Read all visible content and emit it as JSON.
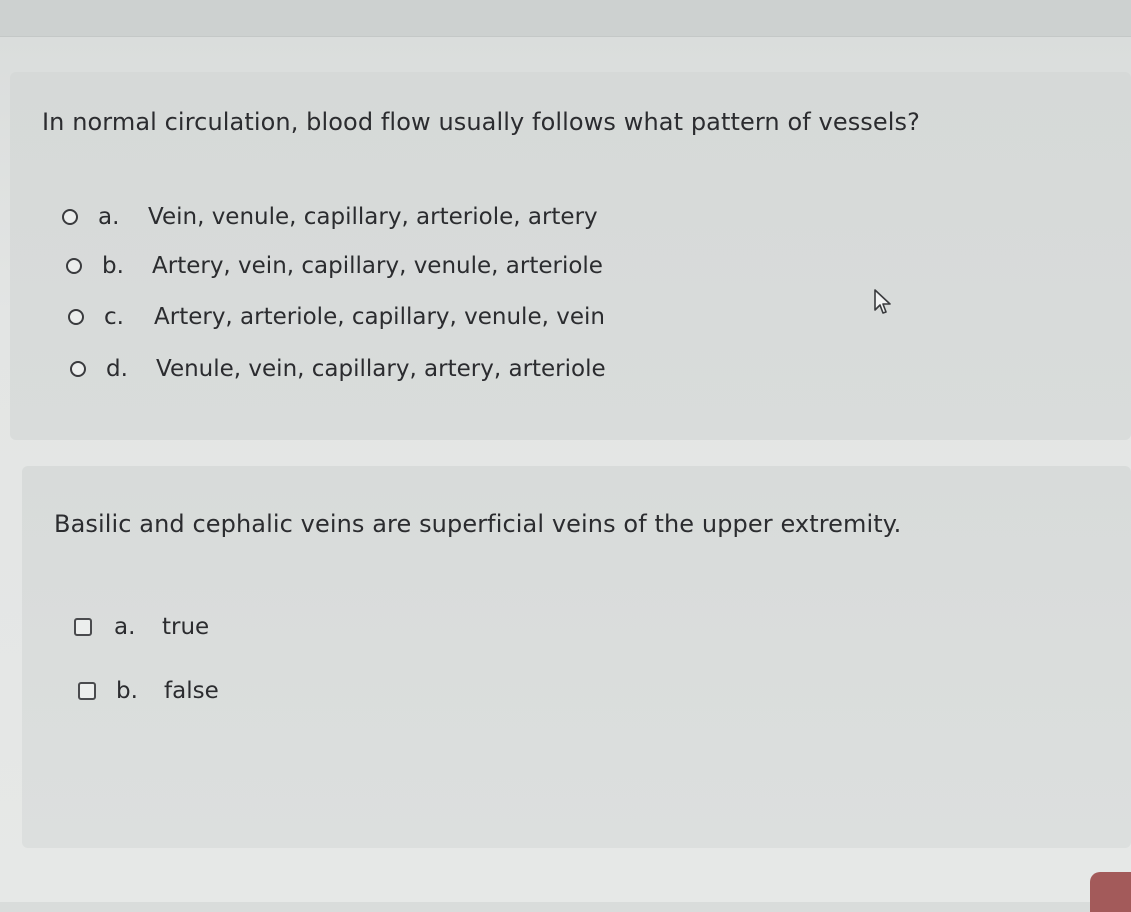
{
  "questions": [
    {
      "text": "In normal circulation, blood flow usually follows what pattern of vessels?",
      "type": "radio",
      "options": [
        {
          "letter": "a.",
          "text": "Vein, venule, capillary, arteriole, artery"
        },
        {
          "letter": "b.",
          "text": "Artery, vein, capillary, venule, arteriole"
        },
        {
          "letter": "c.",
          "text": "Artery, arteriole, capillary, venule, vein"
        },
        {
          "letter": "d.",
          "text": "Venule, vein, capillary, artery, arteriole"
        }
      ]
    },
    {
      "text": "Basilic and cephalic veins are superficial veins of the upper extremity.",
      "type": "checkbox",
      "options": [
        {
          "letter": "a.",
          "text": "true"
        },
        {
          "letter": "b.",
          "text": "false"
        }
      ]
    }
  ],
  "icons": {
    "cursor": "mouse-pointer-icon",
    "radio": "radio-button-icon",
    "checkbox": "checkbox-icon"
  }
}
